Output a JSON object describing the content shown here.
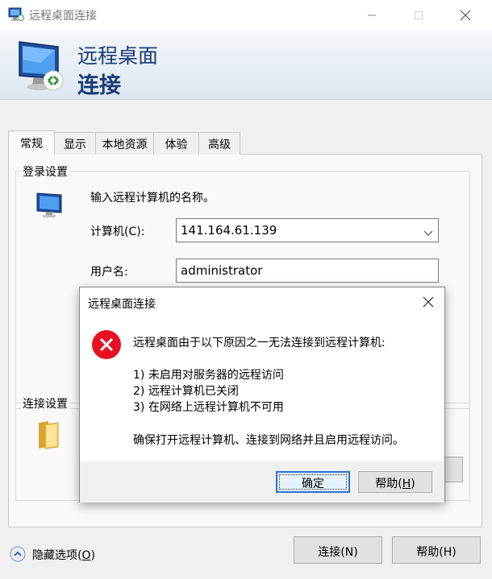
{
  "window": {
    "title": "远程桌面连接",
    "banner_line1": "远程桌面",
    "banner_line2": "连接"
  },
  "tabs": [
    {
      "label": "常规",
      "active": true
    },
    {
      "label": "显示",
      "active": false
    },
    {
      "label": "本地资源",
      "active": false
    },
    {
      "label": "体验",
      "active": false
    },
    {
      "label": "高级",
      "active": false
    }
  ],
  "login_settings": {
    "legend": "登录设置",
    "prompt": "输入远程计算机的名称。",
    "computer_label": "计算机(C):",
    "computer_value": "141.164.61.139",
    "username_label": "用户名:",
    "username_value": "administrator"
  },
  "connection_settings": {
    "legend": "连接设置"
  },
  "bottom": {
    "hide_options_prefix": "隐藏选项(",
    "hide_options_key": "O",
    "hide_options_suffix": ")",
    "connect_label": "连接(N)",
    "help_label": "帮助(H)"
  },
  "dialog": {
    "title": "远程桌面连接",
    "heading": "远程桌面由于以下原因之一无法连接到远程计算机:",
    "reasons": [
      "1) 未启用对服务器的远程访问",
      "2) 远程计算机已关闭",
      "3) 在网络上远程计算机不可用"
    ],
    "advice": "确保打开远程计算机、连接到网络并且启用远程访问。",
    "ok_label": "确定",
    "help_prefix": "帮助(",
    "help_key": "H",
    "help_suffix": ")"
  },
  "colors": {
    "banner_text": "#1a3b78",
    "error_red": "#e81123",
    "default_button_border": "#2b6fcf"
  },
  "icons": {
    "app": "remote-desktop-icon",
    "banner": "remote-desktop-monitor-icon",
    "computer": "computer-icon",
    "folder": "folder-icon",
    "error": "error-icon",
    "hide_options": "chevron-up-circle-icon"
  }
}
